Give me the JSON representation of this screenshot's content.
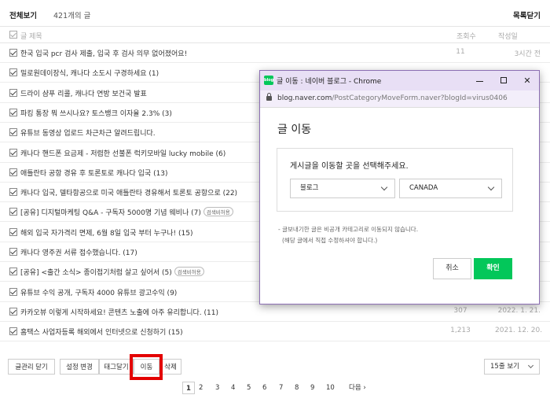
{
  "header": {
    "title": "전체보기",
    "count": "421개의 글",
    "collapse": "목록닫기"
  },
  "columns": {
    "title": "글 제목",
    "views": "조회수",
    "date": "작성일"
  },
  "rows": [
    {
      "title": "한국 입국 pcr 검사 제출, 입국 후 검사 의무 없어졌어요!",
      "tag": "",
      "views": "11",
      "date": "3시간 전"
    },
    {
      "title": "밀로원데이장식, 캐나다 소도시 구경하세요 (1)",
      "tag": "",
      "views": "",
      "date": ""
    },
    {
      "title": "드라이 샴푸 리콜, 캐나다 연방 보건국 발표",
      "tag": "",
      "views": "",
      "date": ""
    },
    {
      "title": "파킹 통장 뭐 쓰시나요? 토스뱅크 이자율 2.3% (3)",
      "tag": "",
      "views": "",
      "date": ""
    },
    {
      "title": "유튜브 동영상 업로드 차근차근 알려드립니다.",
      "tag": "",
      "views": "",
      "date": ""
    },
    {
      "title": "캐나다 핸드폰 요금제 - 저렴한 선불폰 럭키모바일 lucky mobile (6)",
      "tag": "",
      "views": "",
      "date": ""
    },
    {
      "title": "애틀란타 공항 경유 후 토론토로 캐나다 입국 (13)",
      "tag": "",
      "views": "",
      "date": ""
    },
    {
      "title": "캐나다 입국, 델타항공으로 미국 애틀란타 경유해서 토론토 공항으로 (22)",
      "tag": "",
      "views": "",
      "date": ""
    },
    {
      "title": "[공유] 디지털마케팅 Q&A - 구독자 5000명 기념 웨비나 (7)",
      "tag": "검색비허용",
      "views": "",
      "date": ""
    },
    {
      "title": "해외 입국 자가격리 면제, 6월 8일 입국 부터 누구나! (15)",
      "tag": "",
      "views": "",
      "date": ""
    },
    {
      "title": "캐나다 영주권 서류 접수했습니다. (17)",
      "tag": "",
      "views": "",
      "date": ""
    },
    {
      "title": "[공유] <출간 소식> 종이접기처럼 살고 싶어서 (5)",
      "tag": "검색비허용",
      "views": "",
      "date": ""
    },
    {
      "title": "유튜브 수익 공개, 구독자 4000 유튜브 광고수익 (9)",
      "tag": "",
      "views": "",
      "date": ""
    },
    {
      "title": "카카오뷰 이렇게 시작하세요! 콘텐츠 노출에 아주 유리합니다. (11)",
      "tag": "",
      "views": "307",
      "date": "2022. 1. 21."
    },
    {
      "title": "홈택스 사업자등록 해외에서 인터넷으로 신청하기 (15)",
      "tag": "",
      "views": "1,213",
      "date": "2021. 12. 20."
    }
  ],
  "actions": {
    "close_manage": "글관리 닫기",
    "settings": "설정 변경",
    "tag": "태그달기",
    "move": "이동",
    "delete": "삭제"
  },
  "per_page": "15줄 보기",
  "pagination": {
    "pages": [
      "1",
      "2",
      "3",
      "4",
      "5",
      "6",
      "7",
      "8",
      "9",
      "10"
    ],
    "current": "1",
    "next": "다음"
  },
  "popup": {
    "favicon": "blog",
    "window_title": "글 이동 : 네이버 블로그 - Chrome",
    "url_host": "blog.naver.com",
    "url_path": "/PostCategoryMoveForm.naver?blogId=virus0406",
    "heading": "글 이동",
    "prompt": "게시글을 이동할 곳을 선택해주세요.",
    "select_type": "블로그",
    "select_category": "CANADA",
    "note1": "- 글보내기한 글은 비공개 카테고리로 이동되지 않습니다.",
    "note2": "(해당 글에서 직접 수정하셔야 합니다.)",
    "cancel": "취소",
    "confirm": "확인"
  },
  "colors": {
    "accent": "#03c75a",
    "highlight": "#e30000",
    "titlebar": "#e8dff5"
  },
  "icons": [
    "checkbox-icon",
    "chevron-down-icon",
    "lock-icon",
    "minimize-icon",
    "maximize-icon",
    "close-icon",
    "chevron-right-icon"
  ]
}
